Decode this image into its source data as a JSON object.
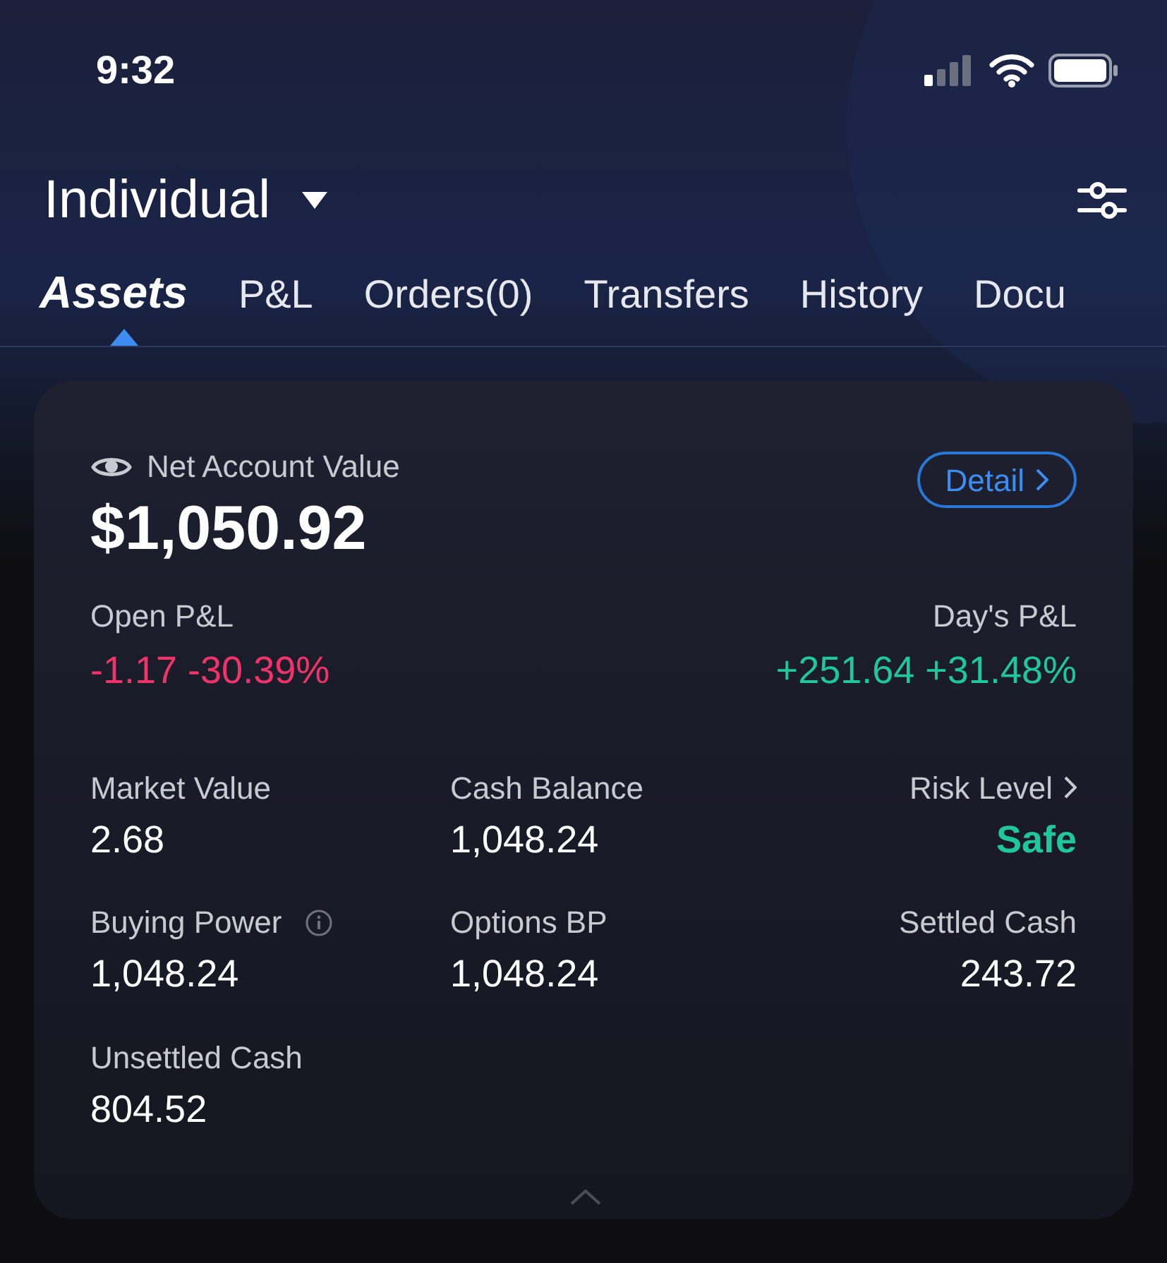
{
  "status_bar": {
    "time": "9:32"
  },
  "header": {
    "account": "Individual"
  },
  "tabs": [
    {
      "label": "Assets",
      "selected": true
    },
    {
      "label": "P&L",
      "selected": false
    },
    {
      "label": "Orders(0)",
      "selected": false
    },
    {
      "label": "Transfers",
      "selected": false
    },
    {
      "label": "History",
      "selected": false
    },
    {
      "label": "Docu",
      "selected": false
    }
  ],
  "card": {
    "title": "Net Account Value",
    "value": "$1,050.92",
    "detail_button": "Detail",
    "pnl": [
      {
        "label": "Open P&L",
        "value": "-1.17 -30.39%",
        "color": "#f0346a"
      },
      {
        "label": "Day's P&L",
        "value": "+251.64 +31.48%",
        "color": "#1ec89a"
      }
    ],
    "metrics": [
      {
        "label": "Market Value",
        "value": "2.68",
        "kind": "plain",
        "color": "#ffffff"
      },
      {
        "label": "Cash Balance",
        "value": "1,048.24",
        "kind": "plain",
        "color": "#ffffff"
      },
      {
        "label": "Risk Level",
        "value": "Safe",
        "kind": "link",
        "color": "#1ec89a"
      },
      {
        "label": "Buying Power",
        "value": "1,048.24",
        "kind": "info",
        "color": "#ffffff"
      },
      {
        "label": "Options BP",
        "value": "1,048.24",
        "kind": "plain",
        "color": "#ffffff"
      },
      {
        "label": "Settled Cash",
        "value": "243.72",
        "kind": "plain",
        "color": "#ffffff"
      },
      {
        "label": "Unsettled Cash",
        "value": "804.52",
        "kind": "plain",
        "color": "#ffffff"
      }
    ]
  }
}
